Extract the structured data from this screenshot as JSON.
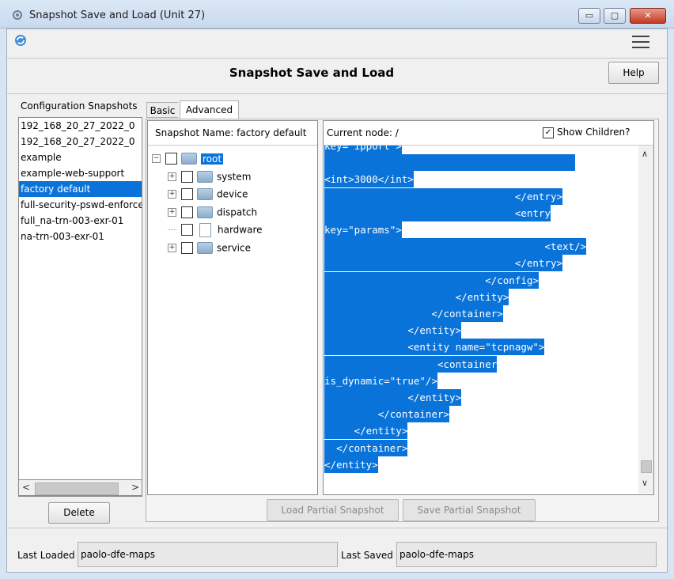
{
  "window": {
    "title": "Snapshot Save and Load (Unit 27)",
    "controls": {
      "minimize": "▭",
      "maximize": "▢",
      "close": "✕"
    }
  },
  "toolbar": {
    "refresh_icon": "refresh-icon",
    "menu_icon": "hamburger-menu-icon"
  },
  "header": {
    "title": "Snapshot Save and Load",
    "help_label": "Help"
  },
  "snapshots": {
    "heading": "Configuration Snapshots",
    "items": [
      "192_168_20_27_2022_0",
      "192_168_20_27_2022_0",
      "example",
      "example-web-support",
      "factory default",
      "full-security-pswd-enforce",
      "full_na-trn-003-exr-01",
      "na-trn-003-exr-01"
    ],
    "selected": "factory default",
    "delete_label": "Delete"
  },
  "tabs": [
    "Basic",
    "Advanced"
  ],
  "active_tab": "Advanced",
  "tree": {
    "heading": "Snapshot Name: factory default",
    "root": "root",
    "children": [
      "system",
      "device",
      "dispatch",
      "hardware",
      "service"
    ]
  },
  "xml": {
    "current_node": "Current node: /",
    "show_children_label": "Show Children?",
    "show_children_checked": true,
    "lines": [
      "key=\"ipport\">",
      "",
      "<int>3000</int>",
      "                                </entry>",
      "                                <entry",
      "key=\"params\">",
      "                                     <text/>",
      "                                </entry>",
      "                           </config>",
      "                      </entity>",
      "                  </container>",
      "              </entity>",
      "              <entity name=\"tcpnagw\">",
      "                   <container",
      "is_dynamic=\"true\"/>",
      "              </entity>",
      "         </container>",
      "     </entity>",
      "  </container>",
      "</entity>"
    ],
    "load_partial_label": "Load Partial Snapshot",
    "save_partial_label": "Save Partial Snapshot"
  },
  "footer": {
    "last_loaded_label": "Last Loaded",
    "last_loaded_value": "paolo-dfe-maps",
    "last_saved_label": "Last Saved",
    "last_saved_value": "paolo-dfe-maps"
  }
}
